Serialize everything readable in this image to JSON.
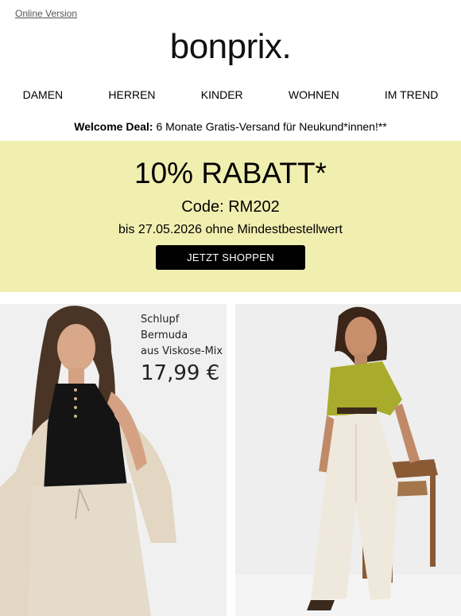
{
  "header": {
    "online_version": "Online Version",
    "logo_text": "bonprix."
  },
  "nav": [
    "DAMEN",
    "HERREN",
    "KINDER",
    "WOHNEN",
    "IM TREND"
  ],
  "welcome": {
    "label": "Welcome Deal:",
    "text": " 6 Monate Gratis-Versand für Neukund*innen!**"
  },
  "promo": {
    "title": "10% RABATT*",
    "code": "Code: RM202",
    "until": "bis 27.05.2026 ohne Mindestbestellwert",
    "cta": "JETZT SHOPPEN",
    "bg_color": "#f1efb0"
  },
  "products": {
    "left": {
      "line1": "Schlupf Bermuda",
      "line2": "aus Viskose-Mix",
      "price": "17,99 €"
    }
  }
}
